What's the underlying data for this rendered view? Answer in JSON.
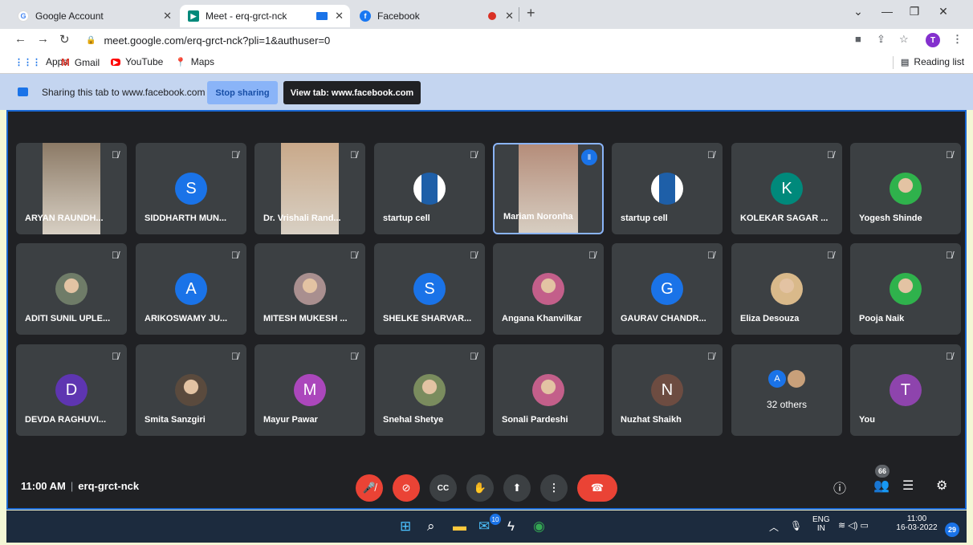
{
  "browser": {
    "tabs": [
      {
        "label": "Google Account",
        "active": false
      },
      {
        "label": "Meet - erq-grct-nck",
        "active": true
      },
      {
        "label": "Facebook",
        "active": false
      }
    ],
    "new_tab": "+",
    "url": "meet.google.com/erq-grct-nck?pli=1&authuser=0",
    "profile_initial": "T",
    "bookmarks": [
      "Apps",
      "Gmail",
      "YouTube",
      "Maps"
    ],
    "reading_list": "Reading list"
  },
  "share_bar": {
    "text": "Sharing this tab to www.facebook.com",
    "stop_label": "Stop sharing",
    "view_label": "View tab: www.facebook.com"
  },
  "participants": [
    {
      "name": "ARYAN RAUNDH...",
      "type": "video",
      "muted": true
    },
    {
      "name": "SIDDHARTH MUN...",
      "type": "initial",
      "initial": "S",
      "color": "#1a73e8",
      "muted": true
    },
    {
      "name": "Dr. Vrishali Rand...",
      "type": "video",
      "muted": true
    },
    {
      "name": "startup cell",
      "type": "logo",
      "muted": true
    },
    {
      "name": "Mariam Noronha",
      "type": "video",
      "speaking": true,
      "muted": false
    },
    {
      "name": "startup cell",
      "type": "logo",
      "muted": true
    },
    {
      "name": "KOLEKAR SAGAR ...",
      "type": "initial",
      "initial": "K",
      "color": "#00897b",
      "muted": true
    },
    {
      "name": "Yogesh Shinde",
      "type": "photo",
      "muted": true
    },
    {
      "name": "ADITI SUNIL UPLE...",
      "type": "photo",
      "muted": true
    },
    {
      "name": "ARIKOSWAMY JU...",
      "type": "initial",
      "initial": "A",
      "color": "#1a73e8",
      "muted": true
    },
    {
      "name": "MITESH MUKESH ...",
      "type": "photo",
      "muted": true
    },
    {
      "name": "SHELKE SHARVAR...",
      "type": "initial",
      "initial": "S",
      "color": "#1a73e8",
      "muted": true
    },
    {
      "name": "Angana Khanvilkar",
      "type": "photo",
      "muted": true
    },
    {
      "name": "GAURAV CHANDR...",
      "type": "initial",
      "initial": "G",
      "color": "#1a73e8",
      "muted": true
    },
    {
      "name": "Eliza Desouza",
      "type": "photo",
      "muted": true
    },
    {
      "name": "Pooja Naik",
      "type": "photo",
      "muted": true
    },
    {
      "name": "DEVDA RAGHUVI...",
      "type": "initial",
      "initial": "D",
      "color": "#5e35b1",
      "muted": true
    },
    {
      "name": "Smita Sanzgiri",
      "type": "photo",
      "muted": true
    },
    {
      "name": "Mayur Pawar",
      "type": "initial",
      "initial": "M",
      "color": "#ab47bc",
      "muted": true
    },
    {
      "name": "Snehal Shetye",
      "type": "photo",
      "muted": true
    },
    {
      "name": "Sonali Pardeshi",
      "type": "photo",
      "muted": false
    },
    {
      "name": "Nuzhat Shaikh",
      "type": "initial",
      "initial": "N",
      "color": "#6d4c41",
      "muted": true
    },
    {
      "name": "32 others",
      "type": "others",
      "muted": false
    },
    {
      "name": "You",
      "type": "initial",
      "initial": "T",
      "color": "#8e44ad",
      "muted": true
    }
  ],
  "others_initial": "A",
  "meeting": {
    "time": "11:00 AM",
    "code": "erq-grct-nck",
    "people_count": "66"
  },
  "taskbar": {
    "lang": "ENG",
    "region": "IN",
    "time": "11:00",
    "date": "16-03-2022",
    "notifications": "29",
    "mail_badge": "10"
  }
}
